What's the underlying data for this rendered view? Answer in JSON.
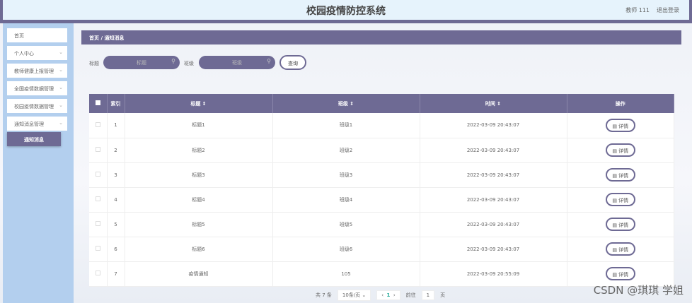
{
  "header": {
    "title": "校园疫情防控系统",
    "user": "教师 111",
    "logout": "退出登录"
  },
  "sidebar": {
    "items": [
      {
        "label": "首页"
      },
      {
        "label": "个人中心"
      },
      {
        "label": "教师健康上报管理"
      },
      {
        "label": "全国疫情数据管理"
      },
      {
        "label": "校园疫情数据管理"
      },
      {
        "label": "通知消息管理"
      }
    ],
    "active_sub": "通知消息"
  },
  "breadcrumb": {
    "home": "首页",
    "sep": "/",
    "current": "通知消息"
  },
  "search": {
    "title_label": "标题",
    "title_placeholder": "标题",
    "class_label": "班级",
    "class_placeholder": "班级",
    "query": "查询"
  },
  "table": {
    "headers": [
      "索引",
      "标题 ⇕",
      "班级 ⇕",
      "时间 ⇕",
      "操作"
    ],
    "detail": "详情",
    "rows": [
      {
        "index": "1",
        "title": "标题1",
        "class": "班级1",
        "time": "2022-03-09 20:43:07"
      },
      {
        "index": "2",
        "title": "标题2",
        "class": "班级2",
        "time": "2022-03-09 20:43:07"
      },
      {
        "index": "3",
        "title": "标题3",
        "class": "班级3",
        "time": "2022-03-09 20:43:07"
      },
      {
        "index": "4",
        "title": "标题4",
        "class": "班级4",
        "time": "2022-03-09 20:43:07"
      },
      {
        "index": "5",
        "title": "标题5",
        "class": "班级5",
        "time": "2022-03-09 20:43:07"
      },
      {
        "index": "6",
        "title": "标题6",
        "class": "班级6",
        "time": "2022-03-09 20:43:07"
      },
      {
        "index": "7",
        "title": "疫情通知",
        "class": "105",
        "time": "2022-03-09 20:55:09"
      }
    ]
  },
  "pagination": {
    "total": "共 7 条",
    "page_size": "10条/页",
    "current": "1",
    "goto": "前往",
    "goto_value": "1",
    "page_unit": "页"
  },
  "watermark": "CSDN @琪琪 学姐"
}
